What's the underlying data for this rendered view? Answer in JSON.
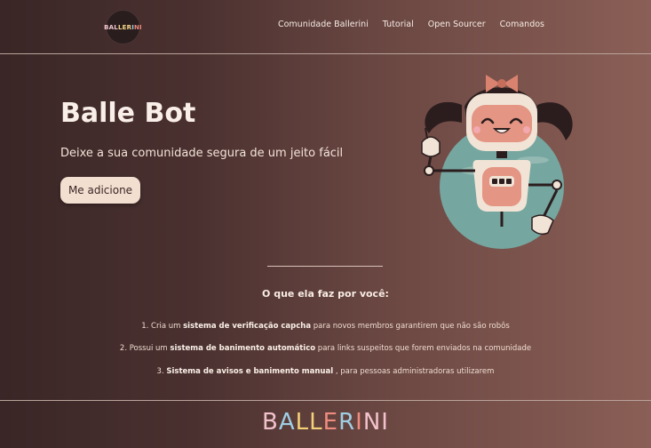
{
  "brand": {
    "logo_text": "BALLERINI"
  },
  "nav": {
    "items": [
      {
        "label": "Comunidade Ballerini"
      },
      {
        "label": "Tutorial"
      },
      {
        "label": "Open Sourcer"
      },
      {
        "label": "Comandos"
      }
    ]
  },
  "hero": {
    "title": "Balle Bot",
    "subtitle": "Deixe a sua comunidade segura de um jeito fácil",
    "cta_label": "Me adicione"
  },
  "features": {
    "title": "O que ela faz por você:",
    "items": [
      {
        "prefix": "1. Cria um ",
        "bold": "sistema de verificação capcha",
        "suffix": " para novos membros garantirem que não são robôs"
      },
      {
        "prefix": "2. Possui um ",
        "bold": "sistema de banimento automático",
        "suffix": " para links suspeitos que forem enviados na comunidade"
      },
      {
        "prefix": "3. ",
        "bold": "Sistema de avisos e banimento manual",
        "suffix": " , para pessoas administradoras utilizarem"
      }
    ]
  },
  "footer": {
    "logo_text": "BALLERINI"
  },
  "colors": {
    "bg_left": "#3a2626",
    "bg_right": "#8a5f56",
    "cta_bg": "#f3dfd0",
    "logo_pink": "#f2c2cc",
    "logo_blue": "#9fcfe4",
    "logo_yellow": "#f3d079",
    "logo_coral": "#ee8b7e"
  },
  "icons": {
    "robot": "robot-illustration",
    "logo": "ballerini-logo"
  }
}
